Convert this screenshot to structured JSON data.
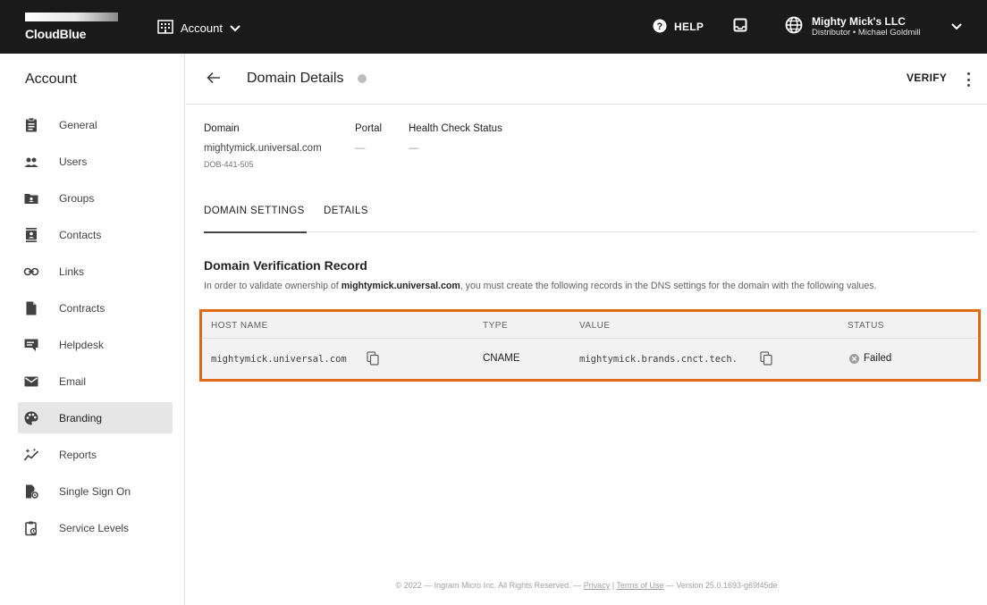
{
  "topbar": {
    "brand": "CloudBlue",
    "module": "Account",
    "help_label": "HELP",
    "account_name": "Mighty Mick's LLC",
    "account_sub": "Distributor • Michael Goldmill"
  },
  "sidebar": {
    "title": "Account",
    "items": [
      {
        "label": "General",
        "icon": "clipboard-icon"
      },
      {
        "label": "Users",
        "icon": "users-icon"
      },
      {
        "label": "Groups",
        "icon": "groups-icon"
      },
      {
        "label": "Contacts",
        "icon": "contacts-icon"
      },
      {
        "label": "Links",
        "icon": "link-icon"
      },
      {
        "label": "Contracts",
        "icon": "contract-icon"
      },
      {
        "label": "Helpdesk",
        "icon": "helpdesk-icon"
      },
      {
        "label": "Email",
        "icon": "email-icon"
      },
      {
        "label": "Branding",
        "icon": "palette-icon",
        "active": true
      },
      {
        "label": "Reports",
        "icon": "reports-icon"
      },
      {
        "label": "Single Sign On",
        "icon": "sso-icon"
      },
      {
        "label": "Service Levels",
        "icon": "service-levels-icon"
      }
    ]
  },
  "header": {
    "title": "Domain Details",
    "verify_label": "VERIFY"
  },
  "details": {
    "domain_label": "Domain",
    "domain_value": "mightymick.universal.com",
    "domain_id": "DOB-441-505",
    "portal_label": "Portal",
    "portal_value": "—",
    "health_label": "Health Check Status",
    "health_value": "—"
  },
  "tabs": [
    {
      "label": "DOMAIN SETTINGS",
      "active": true
    },
    {
      "label": "DETAILS",
      "active": false
    }
  ],
  "section": {
    "title": "Domain Verification Record",
    "desc_before": "In order to validate ownership of ",
    "desc_domain": "mightymick.universal.com",
    "desc_after": ", you must create the following records in the DNS settings for the domain with the following values."
  },
  "table": {
    "columns": [
      "HOST NAME",
      "TYPE",
      "VALUE",
      "STATUS"
    ],
    "rows": [
      {
        "host": "mightymick.universal.com",
        "type": "CNAME",
        "value": "mightymick.brands.cnct.tech.",
        "status": "Failed"
      }
    ]
  },
  "footer": {
    "copyright": "© 2022 — Ingram Micro Inc. All Rights Reserved. — ",
    "privacy": "Privacy",
    "sep": " | ",
    "terms": "Terms of Use",
    "version": " — Version 25.0.1693-g69f45de"
  },
  "colors": {
    "topbar": "#1a1a1a",
    "highlight": "#e06a14",
    "active_nav": "#e6e6e6"
  }
}
